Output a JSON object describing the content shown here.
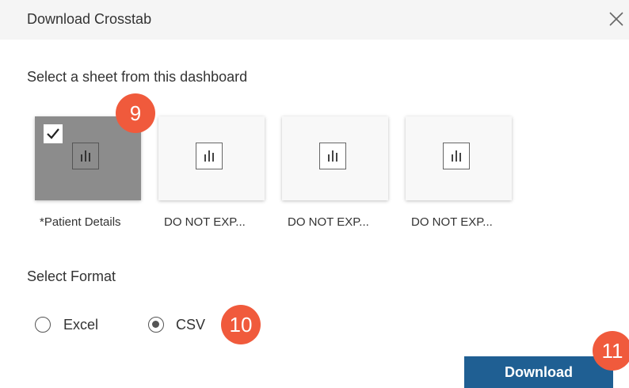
{
  "dialog": {
    "title": "Download Crosstab",
    "close_icon": "close-icon"
  },
  "sheets_section": {
    "label": "Select a sheet from this dashboard",
    "sheets": [
      {
        "label": "*Patient Details",
        "selected": true,
        "icon": "bar-chart-icon"
      },
      {
        "label": "DO NOT EXP...",
        "selected": false,
        "icon": "bar-chart-icon"
      },
      {
        "label": "DO NOT EXP...",
        "selected": false,
        "icon": "bar-chart-icon"
      },
      {
        "label": "DO NOT EXP...",
        "selected": false,
        "icon": "bar-chart-icon"
      }
    ]
  },
  "format_section": {
    "label": "Select Format",
    "options": [
      {
        "label": "Excel",
        "selected": false
      },
      {
        "label": "CSV",
        "selected": true
      }
    ]
  },
  "download_button": {
    "label": "Download"
  },
  "step_badges": [
    "9",
    "10",
    "11"
  ],
  "colors": {
    "accent": "#1f5f93",
    "badge": "#f05a3c",
    "selected_tile": "#8c8c8c"
  }
}
